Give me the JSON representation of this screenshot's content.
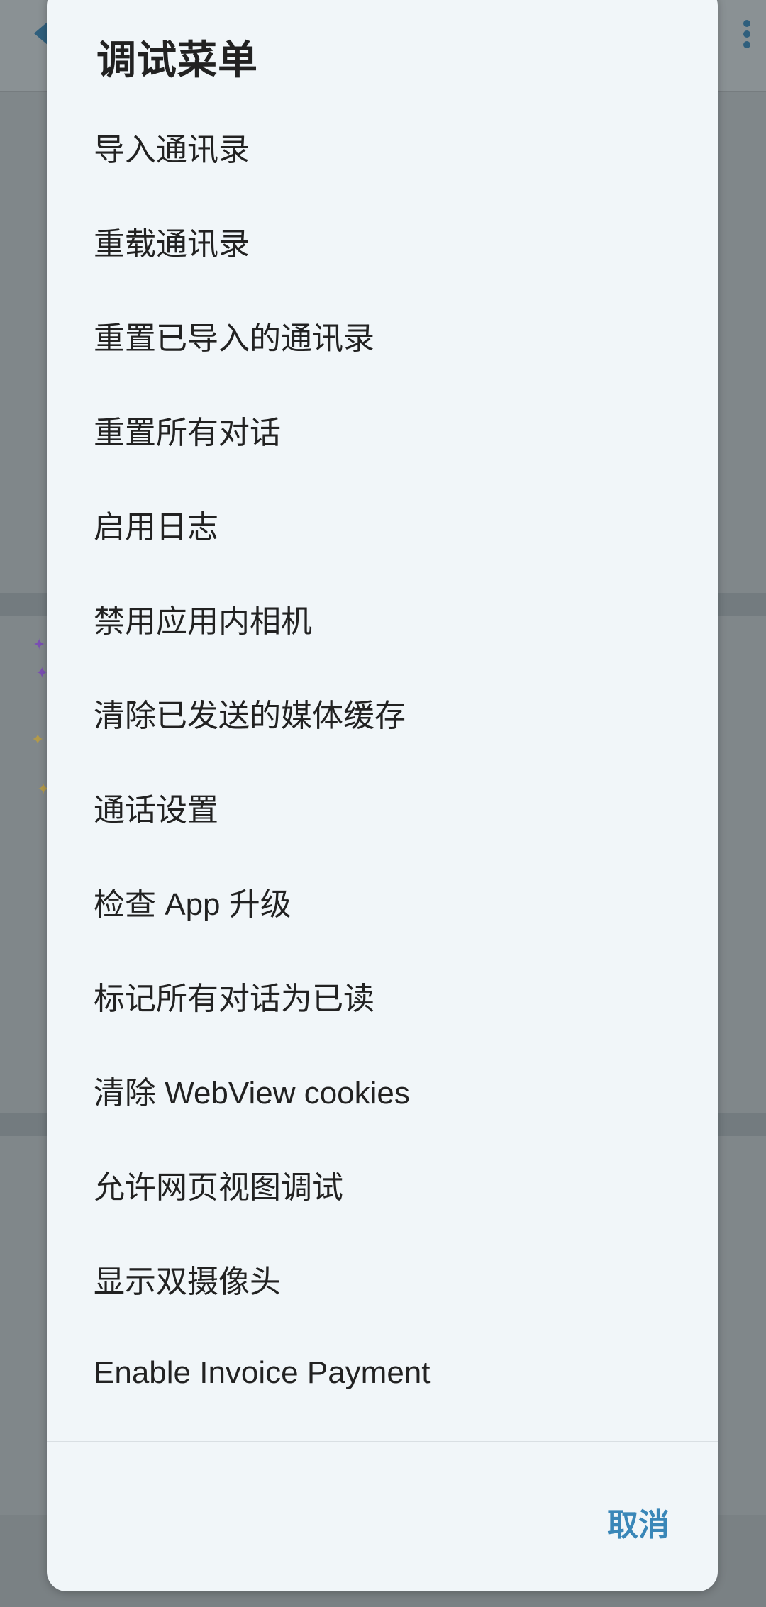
{
  "dialog": {
    "title": "调试菜单",
    "items": [
      "导入通讯录",
      "重载通讯录",
      "重置已导入的通讯录",
      "重置所有对话",
      "启用日志",
      "禁用应用内相机",
      "清除已发送的媒体缓存",
      "通话设置",
      "检查 App 升级",
      "标记所有对话为已读",
      "清除 WebView cookies",
      "允许网页视图调试",
      "显示双摄像头",
      "Enable Invoice Payment"
    ],
    "cancel_label": "取消"
  },
  "colors": {
    "dialog_bg": "#f1f6f9",
    "accent": "#3a87b8",
    "scrim_bg": "#7d8386"
  }
}
